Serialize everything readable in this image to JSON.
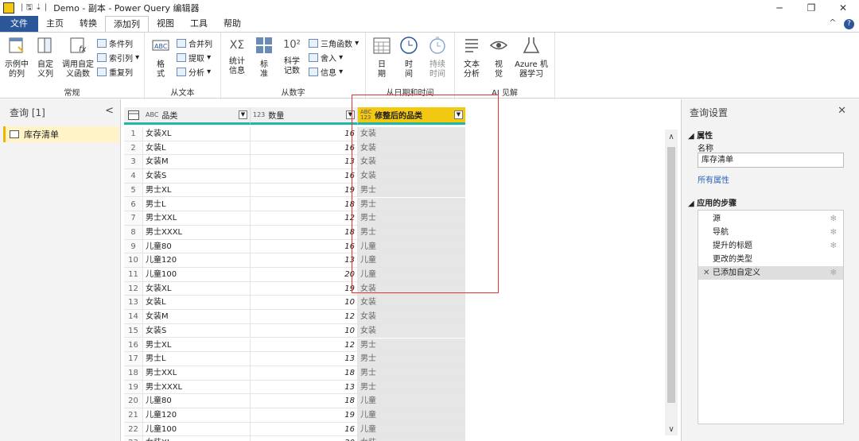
{
  "titlebar": {
    "title": "Demo - 副本 - Power Query 编辑器",
    "qa": "|  🖫 ⇣ |"
  },
  "menu": {
    "tabs": [
      "文件",
      "主页",
      "转换",
      "添加列",
      "视图",
      "工具",
      "帮助"
    ],
    "active_index": 3,
    "help_glyph": "?"
  },
  "ribbon": {
    "groups": {
      "general": {
        "label": "常规",
        "big": [
          "示例中\n的列",
          "自定\n义列",
          "调用自定\n义函数"
        ],
        "small": [
          "条件列",
          "索引列",
          "重复列"
        ]
      },
      "text": {
        "label": "从文本",
        "big": [
          "格\n式"
        ],
        "small": [
          "合并列",
          "提取",
          "分析"
        ]
      },
      "number": {
        "label": "从数字",
        "big": [
          "统计\n信息",
          "标\n准",
          "科学\n记数"
        ],
        "small": [
          "三角函数",
          "舍入",
          "信息"
        ],
        "glyph_sigma": "XΣ",
        "glyph_ten": "10²"
      },
      "datetime": {
        "label": "从日期和时间",
        "big": [
          "日\n期",
          "时\n间",
          "持续\n时间"
        ]
      },
      "ai": {
        "label": "AI 见解",
        "big": [
          "文本\n分析",
          "视\n觉",
          "Azure 机\n器学习"
        ]
      }
    }
  },
  "left": {
    "header": "查询 [1]",
    "collapse": "<",
    "query": "库存清单"
  },
  "grid": {
    "columns": [
      {
        "type": "ABC",
        "name": "品类"
      },
      {
        "type": "123",
        "name": "数量"
      },
      {
        "type": "ABC 123",
        "name": "修整后的品类"
      }
    ],
    "rows": [
      [
        "1",
        "女装XL",
        "16",
        "女装"
      ],
      [
        "2",
        "女装L",
        "16",
        "女装"
      ],
      [
        "3",
        "女装M",
        "13",
        "女装"
      ],
      [
        "4",
        "女装S",
        "16",
        "女装"
      ],
      [
        "5",
        "男士XL",
        "19",
        "男士"
      ],
      [
        "6",
        "男士L",
        "18",
        "男士"
      ],
      [
        "7",
        "男士XXL",
        "12",
        "男士"
      ],
      [
        "8",
        "男士XXXL",
        "18",
        "男士"
      ],
      [
        "9",
        "儿童80",
        "16",
        "儿童"
      ],
      [
        "10",
        "儿童120",
        "13",
        "儿童"
      ],
      [
        "11",
        "儿童100",
        "20",
        "儿童"
      ],
      [
        "12",
        "女装XL",
        "19",
        "女装"
      ],
      [
        "13",
        "女装L",
        "10",
        "女装"
      ],
      [
        "14",
        "女装M",
        "12",
        "女装"
      ],
      [
        "15",
        "女装S",
        "10",
        "女装"
      ],
      [
        "16",
        "男士XL",
        "12",
        "男士"
      ],
      [
        "17",
        "男士L",
        "13",
        "男士"
      ],
      [
        "18",
        "男士XXL",
        "18",
        "男士"
      ],
      [
        "19",
        "男士XXXL",
        "13",
        "男士"
      ],
      [
        "20",
        "儿童80",
        "18",
        "儿童"
      ],
      [
        "21",
        "儿童120",
        "19",
        "儿童"
      ],
      [
        "22",
        "儿童100",
        "16",
        "儿童"
      ],
      [
        "23",
        "女装XL",
        "20",
        "女装"
      ]
    ]
  },
  "right": {
    "title": "查询设置",
    "close": "✕",
    "props_header": "◢ 属性",
    "name_label": "名称",
    "name_value": "库存清单",
    "all_props": "所有属性",
    "steps_header": "◢ 应用的步骤",
    "steps": [
      "源",
      "导航",
      "提升的标题",
      "更改的类型",
      "已添加自定义"
    ]
  }
}
